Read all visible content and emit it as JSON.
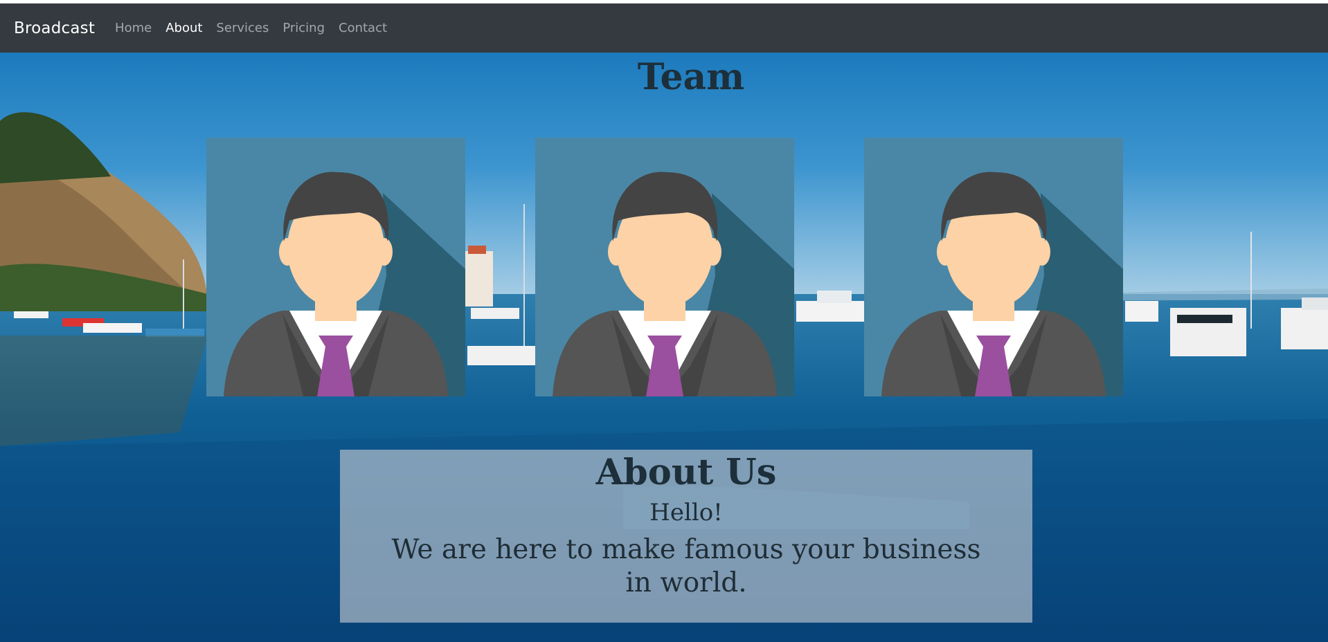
{
  "navbar": {
    "brand": "Broadcast",
    "links": [
      "Home",
      "About",
      "Services",
      "Pricing",
      "Contact"
    ],
    "active": "About"
  },
  "team": {
    "title": "Team",
    "member_count": 3
  },
  "about": {
    "title": "About Us",
    "greeting": "Hello!",
    "text": "We are here to make famous your business in world."
  },
  "icons": {
    "avatar": "businessman-avatar-icon"
  },
  "colors": {
    "navbar_bg": "#343a40",
    "nav_link": "rgba(255,255,255,0.55)",
    "nav_link_active": "#ffffff",
    "heading": "#1d2f3a",
    "avatar_bg": "#4a87a6",
    "avatar_shadow": "#2b5f74",
    "tie": "#9b4f9f",
    "skin": "#fdd2a6",
    "hair": "#444444",
    "suit": "#555555"
  }
}
